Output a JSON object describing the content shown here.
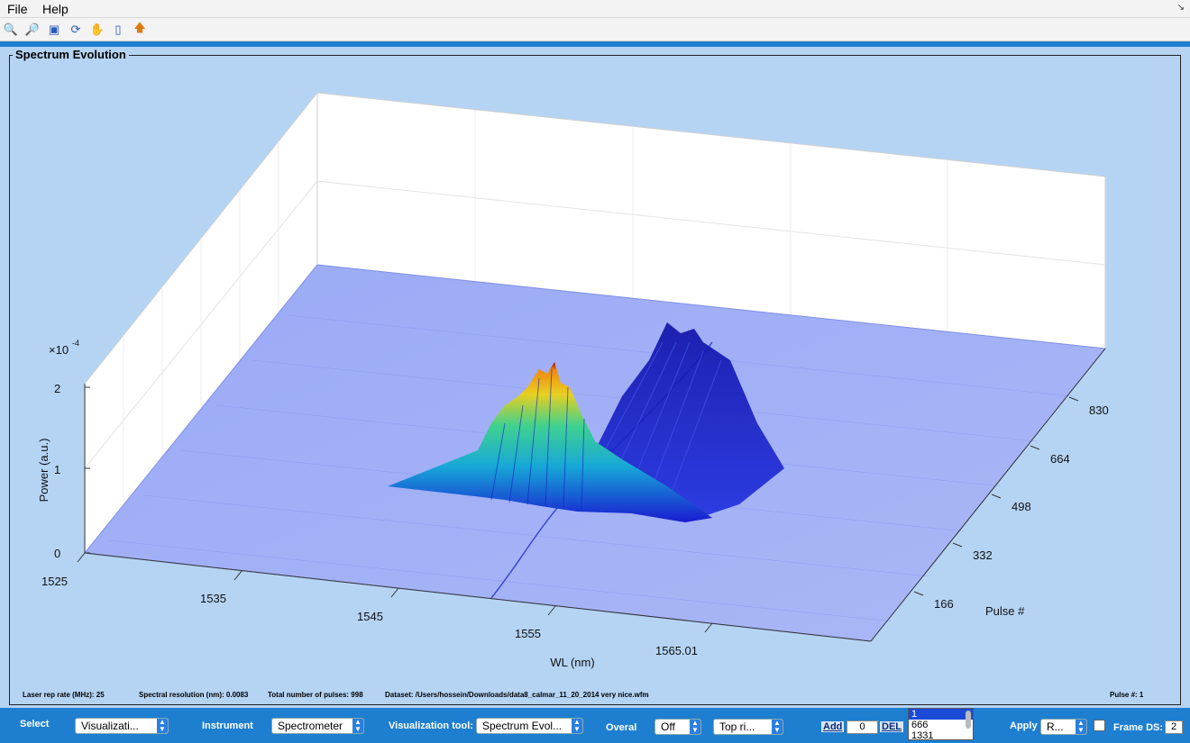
{
  "menu": {
    "file": "File",
    "help": "Help"
  },
  "toolbar_icons": [
    "zoom-in-icon",
    "zoom-out-icon",
    "data-cursor-icon",
    "rotate-3d-icon",
    "pan-hand-icon",
    "colorbar-icon",
    "arrow-up-icon"
  ],
  "panel": {
    "title": "Spectrum Evolution"
  },
  "chart_data": {
    "type": "surface3d",
    "title": "",
    "xlabel": "WL (nm)",
    "ylabel": "Pulse #",
    "zlabel": "Power (a.u.)",
    "z_exponent": "×10",
    "z_exponent_power": "-4",
    "x_ticks": [
      "1525",
      "1535",
      "1545",
      "1555",
      "1565.01"
    ],
    "y_ticks": [
      "166",
      "332",
      "498",
      "664",
      "830"
    ],
    "z_ticks": [
      "0",
      "1",
      "2"
    ],
    "xlim": [
      1525,
      1570
    ],
    "ylim": [
      0,
      998
    ],
    "zlim": [
      0,
      2.5
    ],
    "colormap": "parula",
    "peaks": [
      {
        "wl": 1551,
        "pulse": 250,
        "power": 2.0
      },
      {
        "wl": 1557,
        "pulse": 560,
        "power": 0.9
      }
    ]
  },
  "info": {
    "rep_rate": "Laser rep rate (MHz): 25",
    "resolution": "Spectral resolution (nm): 0.0083",
    "total_pulses": "Total number of pulses: 998",
    "dataset": "Dataset:  /Users/hossein/Downloads/data8_calmar_11_20_2014 very nice.wfm",
    "pulse_num": "Pulse #: 1"
  },
  "controls": {
    "select_label": "Select",
    "select_value": "Visualizati...",
    "instrument_label": "Instrument",
    "instrument_value": "Spectrometer",
    "vis_tool_label": "Visualization tool:",
    "vis_tool_value": "Spectrum Evol...",
    "overal_label": "Overal",
    "overal_value": "Off",
    "position_value": "Top ri...",
    "add_label": "Add",
    "add_value": "0",
    "del_label": "DEL",
    "list_items": [
      "1",
      "666",
      "1331"
    ],
    "apply_label": "Apply",
    "apply_value": "R...",
    "frame_ds_label": "Frame DS:",
    "frame_ds_value": "2"
  }
}
